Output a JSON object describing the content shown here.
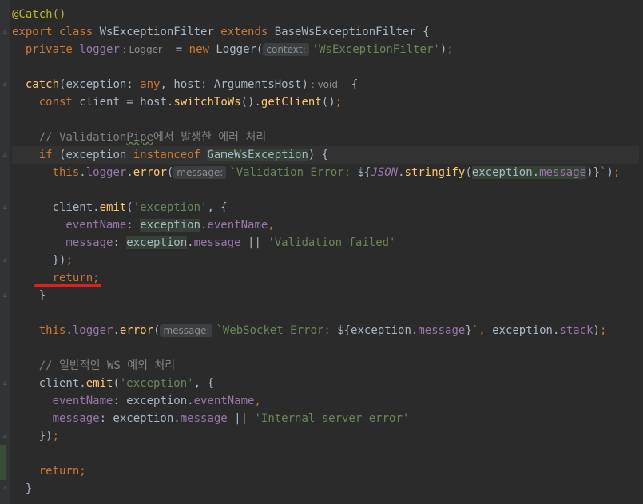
{
  "lines": [
    {
      "t": [
        [
          "ann",
          "@Catch()"
        ]
      ]
    },
    {
      "t": [
        [
          "kw",
          "export class "
        ],
        [
          "typ",
          "WsExceptionFilter "
        ],
        [
          "kw",
          "extends "
        ],
        [
          "typ",
          "BaseWsExceptionFilter {"
        ]
      ]
    },
    {
      "t": [
        [
          "kw",
          "  private "
        ],
        [
          "prop",
          "logger"
        ]
      ],
      "hint": ": Logger",
      "after": [
        [
          "typ",
          "  = "
        ],
        [
          "kw",
          "new "
        ],
        [
          "typ",
          "Logger("
        ]
      ],
      "hint2": "context:",
      "after2": [
        [
          "str",
          "'WsExceptionFilter'"
        ],
        [
          "typ",
          ")"
        ],
        [
          "kw",
          ";"
        ]
      ]
    },
    {
      "t": []
    },
    {
      "t": [
        [
          "fn",
          "  catch"
        ],
        [
          "typ",
          "(exception: "
        ],
        [
          "kw",
          "any"
        ],
        [
          "typ",
          ", host: ArgumentsHost)"
        ]
      ],
      "hint": ": void",
      "after": [
        [
          "typ",
          "  {"
        ]
      ]
    },
    {
      "t": [
        [
          "kw",
          "    const "
        ],
        [
          "typ",
          "client = host."
        ],
        [
          "fn",
          "switchToWs"
        ],
        [
          "typ",
          "()."
        ],
        [
          "fn",
          "getClient"
        ],
        [
          "typ",
          "()"
        ],
        [
          "kw",
          ";"
        ]
      ]
    },
    {
      "t": []
    },
    {
      "t": [
        [
          "cmt",
          "    // ValidationPipe에서 발생한 에러 처리"
        ]
      ]
    },
    {
      "t": [
        [
          "kw",
          "    if "
        ],
        [
          "typ",
          "(exception "
        ],
        [
          "kw",
          "instanceof "
        ],
        [
          "typ hl",
          "GameWsException"
        ],
        [
          "typ",
          ") {"
        ]
      ]
    },
    {
      "t": [
        [
          "kw",
          "      this"
        ],
        [
          "typ",
          "."
        ],
        [
          "prop",
          "logger"
        ],
        [
          "typ",
          "."
        ],
        [
          "fn",
          "error"
        ],
        [
          "typ",
          "("
        ]
      ],
      "hint2": "message:",
      "after2": [
        [
          "str",
          "`Validation Error: "
        ],
        [
          "typ",
          "${"
        ],
        [
          "json",
          "JSON"
        ],
        [
          "typ",
          "."
        ],
        [
          "fn",
          "stringify"
        ],
        [
          "typ",
          "("
        ],
        [
          "typ hl",
          "exception"
        ],
        [
          "typ hl",
          "."
        ],
        [
          "prop hl",
          "message"
        ],
        [
          "typ",
          ")}"
        ],
        [
          "str",
          "`"
        ],
        [
          "typ",
          ")"
        ],
        [
          "kw",
          ";"
        ]
      ]
    },
    {
      "t": []
    },
    {
      "t": [
        [
          "typ",
          "      client."
        ],
        [
          "fn",
          "emit"
        ],
        [
          "typ",
          "("
        ],
        [
          "str",
          "'exception'"
        ],
        [
          "typ",
          ", {"
        ]
      ]
    },
    {
      "t": [
        [
          "prop",
          "        eventName"
        ],
        [
          "typ",
          ": "
        ],
        [
          "typ hl",
          "exception"
        ],
        [
          "typ",
          "."
        ],
        [
          "prop",
          "eventName"
        ],
        [
          "kw",
          ","
        ]
      ]
    },
    {
      "t": [
        [
          "prop",
          "        message"
        ],
        [
          "typ",
          ": "
        ],
        [
          "typ hl",
          "exception"
        ],
        [
          "typ",
          "."
        ],
        [
          "prop",
          "message"
        ],
        [
          "typ",
          " || "
        ],
        [
          "str",
          "'Validation failed'"
        ]
      ]
    },
    {
      "t": [
        [
          "typ",
          "      })"
        ],
        [
          "kw",
          ";"
        ]
      ]
    },
    {
      "t": [
        [
          "kw",
          "      return;"
        ]
      ]
    },
    {
      "t": [
        [
          "typ",
          "    }"
        ]
      ]
    },
    {
      "t": []
    },
    {
      "t": [
        [
          "kw",
          "    this"
        ],
        [
          "typ",
          "."
        ],
        [
          "prop",
          "logger"
        ],
        [
          "typ",
          "."
        ],
        [
          "fn",
          "error"
        ],
        [
          "typ",
          "("
        ]
      ],
      "hint2": "message:",
      "after2": [
        [
          "str",
          "`WebSocket Error: "
        ],
        [
          "typ",
          "${exception."
        ],
        [
          "prop",
          "message"
        ],
        [
          "typ",
          "}"
        ],
        [
          "str",
          "`"
        ],
        [
          "kw",
          ", "
        ],
        [
          "typ",
          "exception."
        ],
        [
          "prop",
          "stack"
        ],
        [
          "typ",
          ")"
        ],
        [
          "kw",
          ";"
        ]
      ]
    },
    {
      "t": []
    },
    {
      "t": [
        [
          "cmt",
          "    // 일반적인 WS 예외 처리"
        ]
      ]
    },
    {
      "t": [
        [
          "typ",
          "    client."
        ],
        [
          "fn",
          "emit"
        ],
        [
          "typ",
          "("
        ],
        [
          "str",
          "'exception'"
        ],
        [
          "typ",
          ", {"
        ]
      ]
    },
    {
      "t": [
        [
          "prop",
          "      eventName"
        ],
        [
          "typ",
          ": exception."
        ],
        [
          "prop",
          "eventName"
        ],
        [
          "kw",
          ","
        ]
      ]
    },
    {
      "t": [
        [
          "prop",
          "      message"
        ],
        [
          "typ",
          ": exception."
        ],
        [
          "prop",
          "message"
        ],
        [
          "typ",
          " || "
        ],
        [
          "str",
          "'Internal server error'"
        ]
      ]
    },
    {
      "t": [
        [
          "typ",
          "    })"
        ],
        [
          "kw",
          ";"
        ]
      ]
    },
    {
      "t": []
    },
    {
      "t": [
        [
          "kw",
          "    return;"
        ]
      ]
    },
    {
      "t": [
        [
          "typ",
          "  }"
        ]
      ]
    }
  ],
  "colors": {
    "background": "#2b2b2b",
    "keyword": "#cc7832",
    "annotation": "#bbb529",
    "function": "#ffc66d",
    "property": "#9876aa",
    "string": "#6a8759",
    "comment": "#808080",
    "text": "#a9b7c6",
    "error_underline": "#e0201a"
  }
}
